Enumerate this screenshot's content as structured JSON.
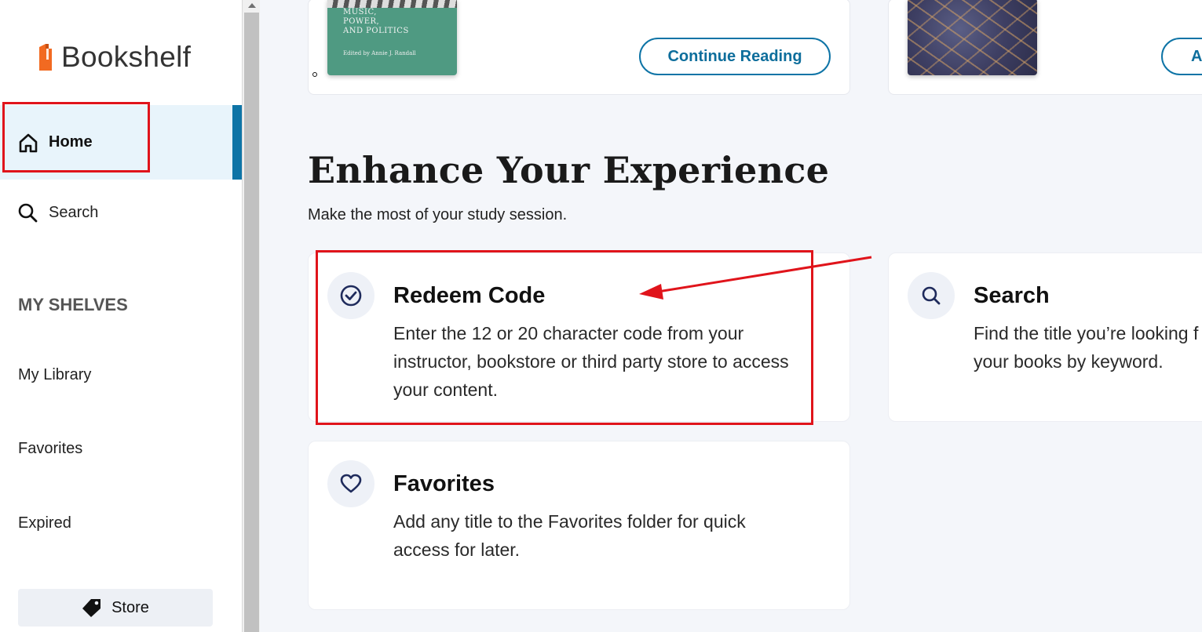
{
  "app": {
    "name": "Bookshelf"
  },
  "sidebar": {
    "home_label": "Home",
    "search_label": "Search",
    "shelves_header": "MY SHELVES",
    "shelves": [
      "My Library",
      "Favorites",
      "Expired"
    ],
    "store_label": "Store"
  },
  "books": [
    {
      "cover_title_lines": [
        "MUSIC,",
        "POWER,",
        "AND POLITICS"
      ],
      "cover_editor": "Edited by Annie J. Randall",
      "button_label": "Continue Reading"
    },
    {
      "button_label": "A"
    }
  ],
  "section": {
    "title": "Enhance Your Experience",
    "subtitle": "Make the most of your study session."
  },
  "cards": [
    {
      "title": "Redeem Code",
      "desc_lines": [
        "Enter the 12 or 20 character code from your",
        "instructor, bookstore or third party store to access",
        "your content."
      ],
      "icon": "check-circle-icon"
    },
    {
      "title": "Search",
      "desc_lines": [
        "Find the title you’re looking f",
        "your books by keyword."
      ],
      "icon": "search-icon"
    },
    {
      "title": "Favorites",
      "desc_lines": [
        "Add any title to the Favorites folder for quick",
        "access for later."
      ],
      "icon": "heart-icon"
    }
  ],
  "colors": {
    "accent": "#0e74a6",
    "annotation": "#e0141b",
    "logo_orange": "#f26a21"
  }
}
